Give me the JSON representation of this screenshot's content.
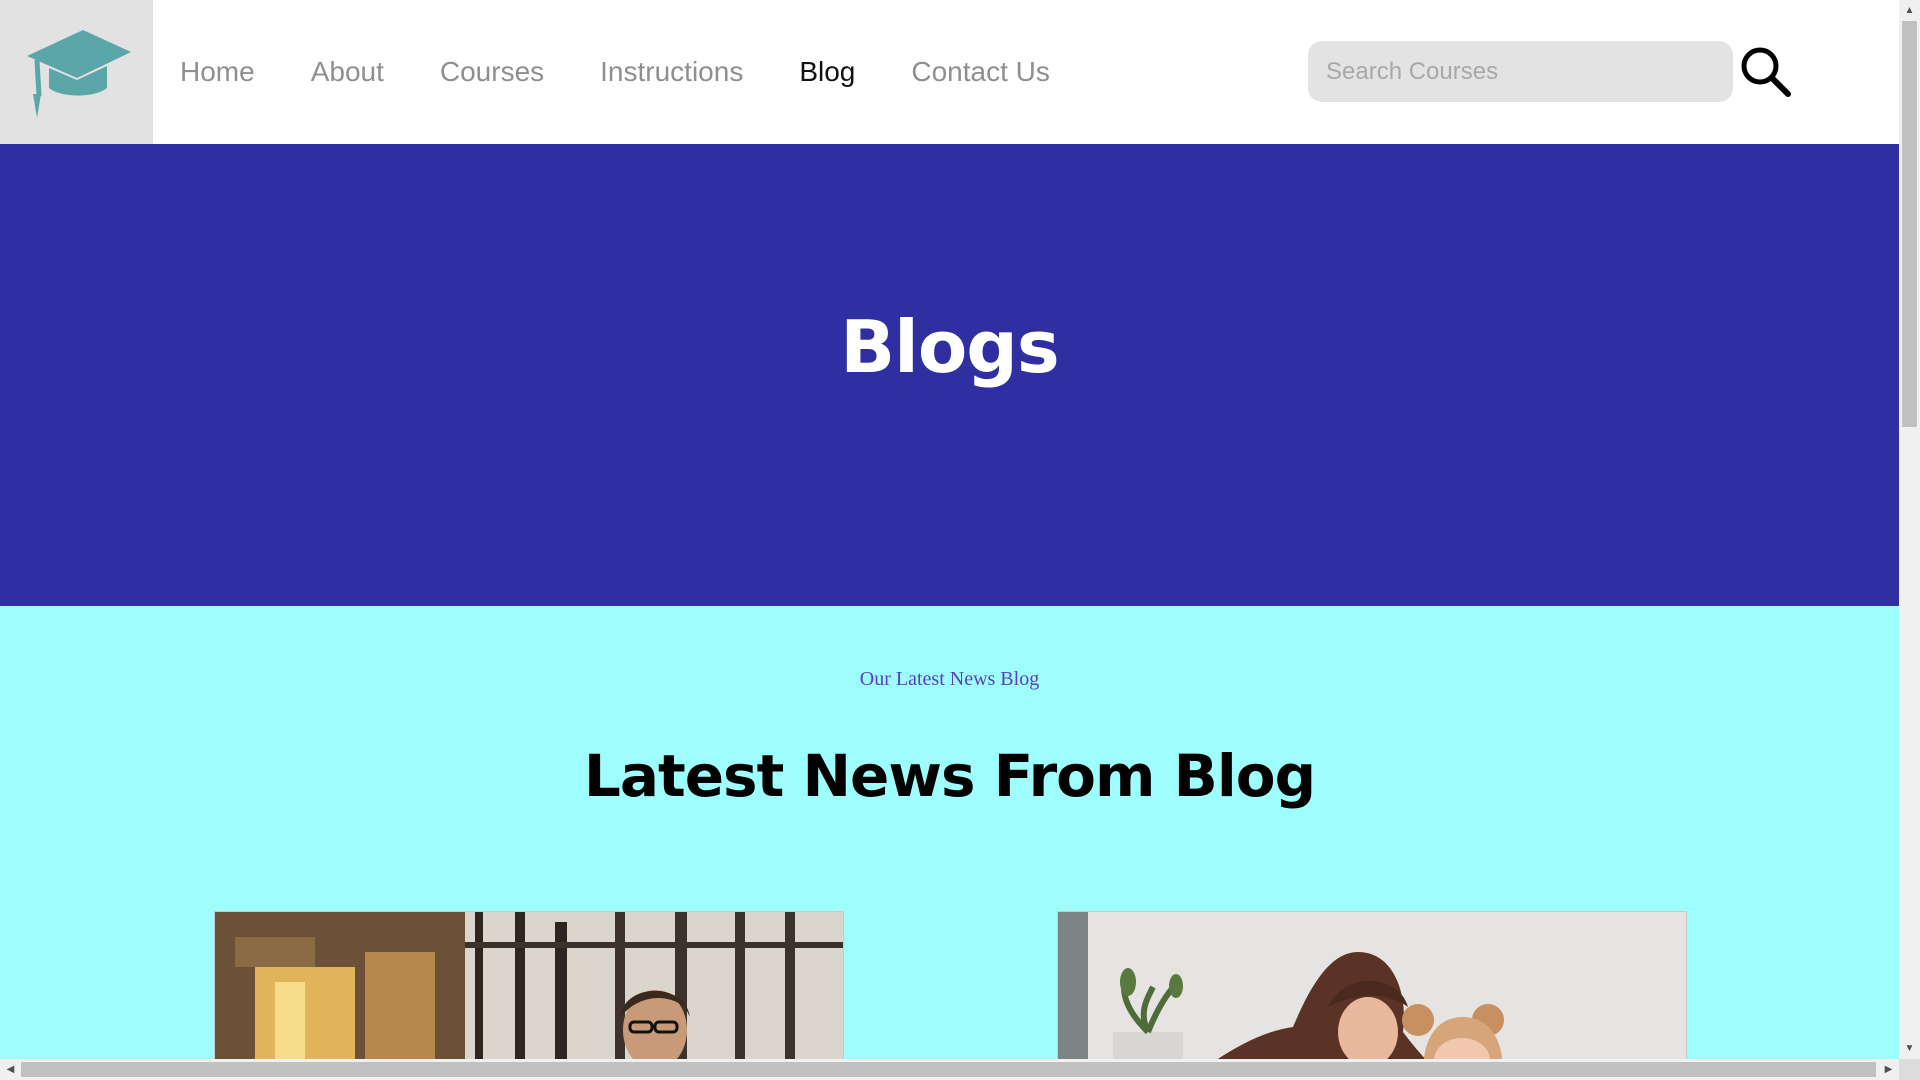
{
  "header": {
    "logo_icon": "graduation-cap-icon",
    "nav": [
      {
        "label": "Home",
        "active": false
      },
      {
        "label": "About",
        "active": false
      },
      {
        "label": "Courses",
        "active": false
      },
      {
        "label": "Instructions",
        "active": false
      },
      {
        "label": "Blog",
        "active": true
      },
      {
        "label": "Contact Us",
        "active": false
      }
    ],
    "search": {
      "placeholder": "Search Courses",
      "value": "",
      "icon": "search-icon"
    }
  },
  "hero": {
    "title": "Blogs"
  },
  "blog": {
    "kicker": "Our Latest News Blog",
    "heading": "Latest News From Blog",
    "cards": [
      {
        "image": "man-with-glasses-in-cafe-photo"
      },
      {
        "image": "mother-and-daughter-photo"
      }
    ]
  },
  "colors": {
    "hero_bg": "#2f2fa2",
    "section_bg": "#9efdfd",
    "logo_bg": "#e2e2e2",
    "logo_icon": "#5ba6a8",
    "nav_text": "#8f8f8f",
    "nav_active": "#111111",
    "kicker": "#5a3fc0"
  }
}
